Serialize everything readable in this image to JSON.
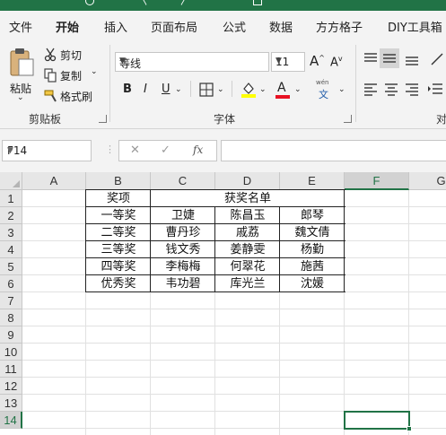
{
  "ribbon_tabs": [
    "文件",
    "开始",
    "插入",
    "页面布局",
    "公式",
    "数据",
    "方方格子",
    "DIY工具箱"
  ],
  "active_tab": "开始",
  "clipboard": {
    "paste": "粘贴",
    "cut": "剪切",
    "copy": "复制",
    "format_painter": "格式刷",
    "group_label": "剪贴板"
  },
  "font": {
    "name": "等线",
    "size": "11",
    "grow": "A",
    "shrink": "A",
    "bold": "B",
    "italic": "I",
    "underline": "U",
    "font_color": "A",
    "phonetic_top": "wén",
    "phonetic_bottom": "文",
    "group_label": "字体",
    "highlight_color": "#ffff00",
    "text_color": "#e81123"
  },
  "alignment_group_label_partial": "对",
  "name_box": "F14",
  "formula_buttons": {
    "cancel": "✕",
    "enter": "✓",
    "insert_function": "fx"
  },
  "columns": [
    "A",
    "B",
    "C",
    "D",
    "E",
    "F",
    "G"
  ],
  "rows": [
    "1",
    "2",
    "3",
    "4",
    "5",
    "6",
    "7",
    "8",
    "9",
    "10",
    "11",
    "12",
    "13",
    "14"
  ],
  "selected_cell": {
    "column": "F",
    "row": "14"
  },
  "table": {
    "header": [
      "奖项",
      "获奖名单"
    ],
    "rows": [
      [
        "一等奖",
        "卫婕",
        "陈昌玉",
        "郎琴"
      ],
      [
        "二等奖",
        "曹丹珍",
        "戚荔",
        "魏文倩"
      ],
      [
        "三等奖",
        "钱文秀",
        "姜静雯",
        "杨勤"
      ],
      [
        "四等奖",
        "李梅梅",
        "何翠花",
        "施茜"
      ],
      [
        "优秀奖",
        "韦功碧",
        "库光兰",
        "沈媛"
      ]
    ]
  },
  "accent_color": "#217346"
}
